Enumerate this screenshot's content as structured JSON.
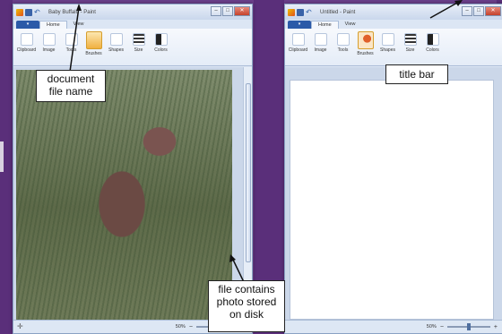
{
  "left_window": {
    "title": "Baby Buffalo - Paint",
    "file_btn": "▾",
    "tabs": [
      "Home",
      "View"
    ],
    "groups": [
      "Clipboard",
      "Image",
      "Tools",
      "Brushes",
      "Shapes",
      "Size",
      "Colors"
    ],
    "zoom_text": "50%",
    "zoom_level": 0.5
  },
  "right_window": {
    "title": "Untitled - Paint",
    "file_btn": "▾",
    "tabs": [
      "Home",
      "View"
    ],
    "groups": [
      "Clipboard",
      "Image",
      "Tools",
      "Brushes",
      "Shapes",
      "Size",
      "Colors"
    ],
    "zoom_text": "50%",
    "zoom_level": 0.5
  },
  "window_controls": {
    "minimize": "–",
    "maximize": "□",
    "close": "✕"
  },
  "callouts": {
    "document_file_name": "document file name",
    "title_bar": "title bar",
    "file_contains": "file contains photo stored on disk"
  },
  "colors": {
    "background": "#6b3f8a",
    "ribbon": "#e4ecf7",
    "file_button": "#2b5aa8",
    "callout_border": "#222222"
  },
  "icons": [
    "paint-icon",
    "save-icon",
    "undo-icon",
    "add-icon",
    "zoom-minus-icon",
    "zoom-plus-icon"
  ]
}
